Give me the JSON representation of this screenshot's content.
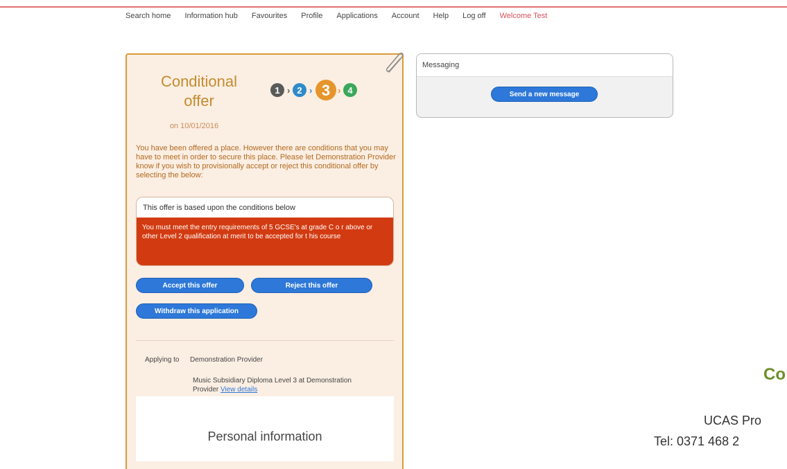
{
  "nav": {
    "items": [
      "Search home",
      "Information hub",
      "Favourites",
      "Profile",
      "Applications",
      "Account",
      "Help",
      "Log off"
    ],
    "welcome": "Welcome Test"
  },
  "offer": {
    "title_line1": "Conditional",
    "title_line2": "offer",
    "date": "on 10/01/2016",
    "steps": [
      "1",
      "2",
      "3",
      "4"
    ],
    "current_step": 3,
    "description": "You have been offered a place. However there are conditions that you may have to meet in order to secure this place. Please let Demonstration Provider know if you wish to provisionally accept or reject this conditional offer by selecting the below:",
    "conditions_heading": "This offer is based upon the conditions below",
    "condition_text": "You must meet the entry requirements of 5 GCSE's at grade C o r above or other Level 2 qualification at merit to be accepted for t his course",
    "accept_label": "Accept this offer",
    "reject_label": "Reject this offer",
    "withdraw_label": "Withdraw this application",
    "applying_label": "Applying to",
    "applying_value": "Demonstration Provider",
    "course_text": "Music Subsidiary Diploma Level 3 at Demonstration Provider",
    "view_details": "View details",
    "personal_title": "Personal information"
  },
  "messaging": {
    "title": "Messaging",
    "send_label": "Send a new message"
  },
  "contact": {
    "heading": "Co",
    "line1": "UCAS Pro",
    "line2": "Tel: 0371 468 2"
  },
  "colors": {
    "accent_orange": "#d99a3a",
    "button_blue": "#2d78d8",
    "condition_red": "#d23b11",
    "welcome_red": "#d6515c",
    "contact_green": "#6d8f2a"
  }
}
